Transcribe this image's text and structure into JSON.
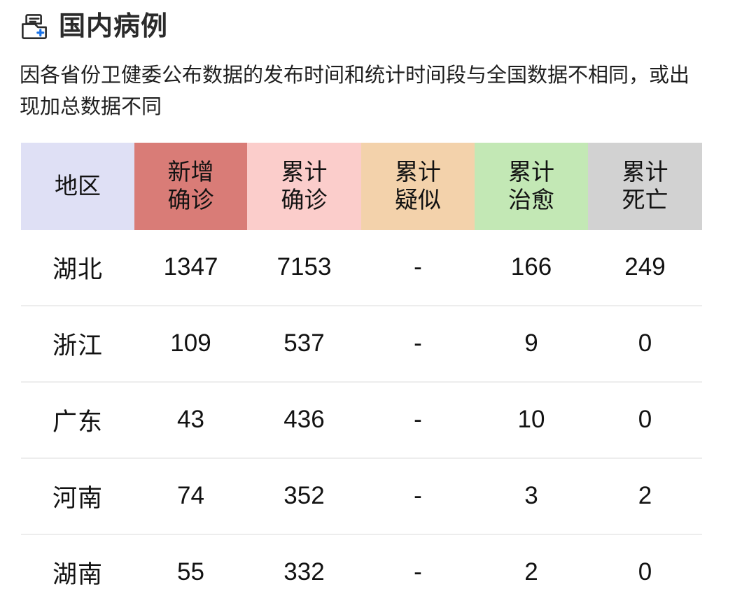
{
  "header": {
    "icon": "case-file-plus-icon",
    "title": "国内病例"
  },
  "description": "因各省份卫健委公布数据的发布时间和统计时间段与全国数据不相同，或出现加总数据不同",
  "table": {
    "columns": [
      {
        "key": "region",
        "line1": "地区",
        "line2": "",
        "bg": "#dfe0f5"
      },
      {
        "key": "new_confirmed",
        "line1": "新增",
        "line2": "确诊",
        "bg": "#d97c77"
      },
      {
        "key": "total_confirmed",
        "line1": "累计",
        "line2": "确诊",
        "bg": "#fbcdcb"
      },
      {
        "key": "total_suspected",
        "line1": "累计",
        "line2": "疑似",
        "bg": "#f3d2ab"
      },
      {
        "key": "total_cured",
        "line1": "累计",
        "line2": "治愈",
        "bg": "#c3e8b5"
      },
      {
        "key": "total_deaths",
        "line1": "累计",
        "line2": "死亡",
        "bg": "#d2d2d2"
      }
    ],
    "rows": [
      {
        "region": "湖北",
        "new_confirmed": "1347",
        "total_confirmed": "7153",
        "total_suspected": "-",
        "total_cured": "166",
        "total_deaths": "249"
      },
      {
        "region": "浙江",
        "new_confirmed": "109",
        "total_confirmed": "537",
        "total_suspected": "-",
        "total_cured": "9",
        "total_deaths": "0"
      },
      {
        "region": "广东",
        "new_confirmed": "43",
        "total_confirmed": "436",
        "total_suspected": "-",
        "total_cured": "10",
        "total_deaths": "0"
      },
      {
        "region": "河南",
        "new_confirmed": "74",
        "total_confirmed": "352",
        "total_suspected": "-",
        "total_cured": "3",
        "total_deaths": "2"
      },
      {
        "region": "湖南",
        "new_confirmed": "55",
        "total_confirmed": "332",
        "total_suspected": "-",
        "total_cured": "2",
        "total_deaths": "0"
      }
    ]
  },
  "colors": {
    "page_background": "#ffffff",
    "title_text": "#2b2b2b",
    "body_text": "#1e1e1e",
    "row_divider": "#ededed",
    "icon_outline": "#2b2b2b",
    "icon_accent": "#1a73e8"
  }
}
